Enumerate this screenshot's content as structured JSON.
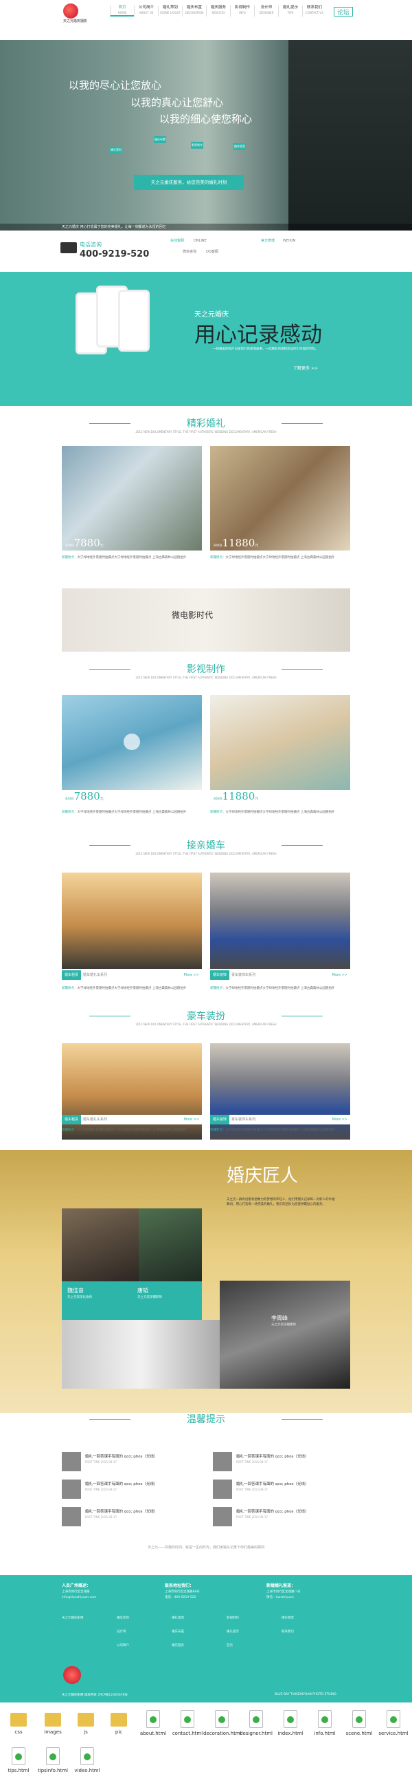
{
  "brand": {
    "logo_text": "天之元婚庆摄影"
  },
  "nav": {
    "items": [
      {
        "label": "首页",
        "en": "HOME"
      },
      {
        "label": "公司简介",
        "en": "ABOUT US"
      },
      {
        "label": "婚礼策划",
        "en": "SCENE LAYOUT"
      },
      {
        "label": "婚庆布置",
        "en": "DECORATION"
      },
      {
        "label": "婚庆服务",
        "en": "SERVICES"
      },
      {
        "label": "影视制作",
        "en": "INFO"
      },
      {
        "label": "设计师",
        "en": "DESIGNER"
      },
      {
        "label": "婚礼提示",
        "en": "TIPS"
      },
      {
        "label": "联系我们",
        "en": "CONTACT US"
      }
    ],
    "forum": "论坛"
  },
  "hero": {
    "lines": [
      "以我的尽心让您放心",
      "以我的真心让您舒心",
      "以我的细心使您称心"
    ],
    "dots": [
      "婚礼策划",
      "婚庆布置",
      "影视制作",
      "婚车租赁"
    ],
    "tagline": "天之元婚庆服务，给您完美的婚礼时刻",
    "caption": "天之元婚庆 用心打造属于您的完美婚礼，让每一刻都成为永恒的回忆"
  },
  "contact": {
    "phone_label": "电话咨询",
    "phone": "400-9219-520",
    "online_label": "在线客服",
    "online_en": "ONLINE",
    "weixin_label": "微信咨询",
    "weixin_en": "WEIXIN",
    "qq_label": "QQ客服",
    "weibo_label": "官方微博"
  },
  "intro": {
    "small": "天之元婚庆",
    "big": "用心记录感动",
    "desc": "一组唯美的照片记录你们的爱情故事，一段精彩的视频见证你们幸福的时刻。",
    "more": "了解更多 >>"
  },
  "sections": [
    {
      "title": "精彩婚礼",
      "sub": "2015 NEW DOCUMENTARY STYLE, THE FIRST AUTHENTIC WEDDING DOCUMENTARY, AMERICAN FRESH"
    },
    {
      "title": "影视制作",
      "sub": "2015 NEW DOCUMENTARY STYLE, THE FIRST AUTHENTIC WEDDING DOCUMENTARY, AMERICAN FRESH"
    },
    {
      "title": "接亲婚车",
      "sub": "2015 NEW DOCUMENTARY STYLE, THE FIRST AUTHENTIC WEDDING DOCUMENTARY, AMERICAN FRESH"
    },
    {
      "title": "豪车装扮",
      "sub": "2015 NEW DOCUMENTARY STYLE, THE FIRST AUTHENTIC WEDDING DOCUMENTARY, AMERICAN FRESH"
    }
  ],
  "wedding_cards": [
    {
      "rmb": "RMB",
      "price": "7880",
      "unit": "元",
      "lead": "新疆原点：",
      "desc": "大宁绿地经外景随时拍摄点大宁绿地经外景随时拍摄点 上海古典森林公园随拍外"
    },
    {
      "rmb": "RMB",
      "price": "11880",
      "unit": "元",
      "lead": "新疆原点：",
      "desc": "大宁绿地经外景随时拍摄点大宁绿地经外景随时拍摄点 上海古典森林公园随拍外"
    }
  ],
  "micro": {
    "title": "微电影时代"
  },
  "video_cards": [
    {
      "rmb": "RMB",
      "price": "7880",
      "unit": "元",
      "lead": "新疆原点：",
      "desc": "大宁绿地经外景随时拍摄点大宁绿地经外景随时拍摄点 上海古典森林公园随拍外"
    },
    {
      "rmb": "RMB",
      "price": "11880",
      "unit": "元",
      "lead": "新疆原点：",
      "desc": "大宁绿地经外景随时拍摄点大宁绿地经外景随时拍摄点 上海古典森林公园随拍外"
    }
  ],
  "car_cards": [
    {
      "tag": "婚车租赁",
      "title": "婚车婚礼车系列",
      "more": "More >>",
      "lead": "新疆原点：",
      "desc": "大宁绿地经外景随时拍摄点大宁绿地经外景随时拍摄点 上海古典森林公园随拍外"
    },
    {
      "tag": "婚车装饰",
      "title": "豪车装饰车系列",
      "more": "More >>",
      "lead": "新疆原点：",
      "desc": "大宁绿地经外景随时拍摄点大宁绿地经外景随时拍摄点 上海古典森林公园随拍外"
    }
  ],
  "deco_cards": [
    {
      "tag": "婚车租赁",
      "title": "婚车婚礼车系列",
      "more": "More >>",
      "lead": "新疆原点：",
      "desc": "大宁绿地经外景随时拍摄点大宁绿地经外景随时拍摄点 上海古典森林公园随拍外"
    },
    {
      "tag": "婚车装饰",
      "title": "豪车装饰车系列",
      "more": "More >>",
      "lead": "新疆原点：",
      "desc": "大宁绿地经外景随时拍摄点大宁绿地经外景随时拍摄点 上海古典森林公园随拍外"
    }
  ],
  "crew": {
    "title": "婚庆匠人",
    "desc": "天之元一群有创意有想象力有梦想的年轻人，他们用镜头记录每一对新人的幸福瞬间，用心打造每一场完美的婚礼。我们的团队为您提供最贴心的服务。",
    "members": [
      {
        "name": "魏佳音",
        "note": "天之元资深化妆师"
      },
      {
        "name": "唐韬",
        "note": "天之元资深摄影师"
      },
      {
        "name": "李周峰",
        "note": "天之元资深摄像师"
      }
    ]
  },
  "tips": {
    "title": "温馨提示",
    "items": [
      {
        "title": "婚礼一回答课手有面的 qco; phos（光线）",
        "date": "POST TIME 2015-08-17"
      },
      {
        "title": "婚礼一回答课手有面的 qco; phos（光线）",
        "date": "POST TIME 2015-08-17"
      },
      {
        "title": "婚礼一回答课手有面的 qco; phos（光线）",
        "date": "POST TIME 2015-08-17"
      },
      {
        "title": "婚礼一回答课手有面的 qco; phos（光线）",
        "date": "POST TIME 2015-08-17"
      },
      {
        "title": "婚礼一回答课手有面的 qco; phos（光线）",
        "date": "POST TIME 2015-08-17"
      },
      {
        "title": "婚礼一回答课手有面的 qco; phos（光线）",
        "date": "POST TIME 2015-08-17"
      }
    ],
    "quote": "天之元——你我的时间，就是一生的时光，我们用镜头记录下你们最美的瞬间"
  },
  "footer": {
    "col1": {
      "title": "人员广场概述：",
      "lines": [
        "上海市闵行区宝城路",
        "info@tianzhiyuan.com"
      ]
    },
    "col2": {
      "title": "联系地址我们：",
      "lines": [
        "上海市闵行区宝城路88号",
        "电话：400-9219-520"
      ]
    },
    "col3": {
      "title": "新婚婚礼报道：",
      "lines": [
        "上海市闵行区宝城路八号",
        "微信：tianzhiyuan"
      ]
    },
    "links": [
      "天之元婚庆影楼",
      "婚车装饰",
      "婚礼策划",
      "影视制作",
      "婚车租赁",
      "设计师",
      "婚庆布置",
      "婚礼提示",
      "联系我们",
      "公司简介",
      "婚庆服务",
      "首页"
    ],
    "copyright": "天之元婚庆影楼 版权所有  沪ICP备12345678号",
    "credit": "BLUE BAY TIANZHIYUAN PHOTO STUDIO"
  },
  "files": [
    "css",
    "images",
    "js",
    "pic",
    "about.html",
    "contact.html",
    "decoration.html",
    "designer.html",
    "index.html",
    "info.html",
    "scene.html",
    "service.html",
    "tips.html",
    "tipsinfo.html",
    "video.html"
  ]
}
